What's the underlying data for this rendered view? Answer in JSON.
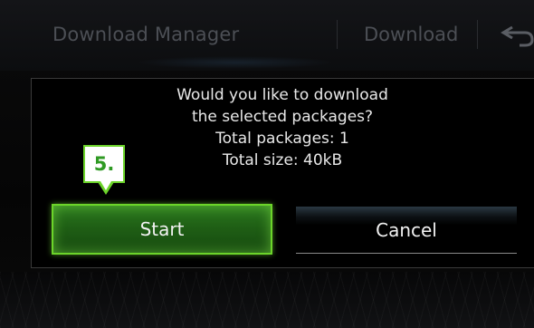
{
  "header": {
    "title": "Download Manager",
    "download_label": "Download",
    "back_icon": "back-arrow-icon"
  },
  "dialog": {
    "message_lines": [
      "Would you like to download",
      "the selected packages?",
      "Total packages: 1",
      "Total size: 40kB"
    ],
    "start_label": "Start",
    "cancel_label": "Cancel"
  },
  "badge": {
    "label": "5."
  },
  "colors": {
    "accent_green": "#6cd42a",
    "badge_text": "#2f9a23",
    "header_text": "#4c4f55"
  }
}
